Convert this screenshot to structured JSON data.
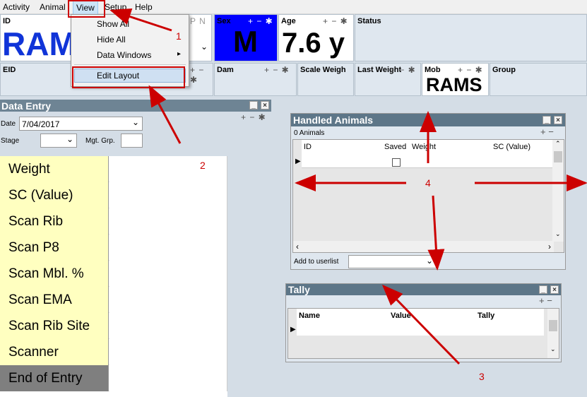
{
  "menubar": {
    "items": [
      "Activity",
      "Animal",
      "View",
      "Setup",
      "Help"
    ]
  },
  "view_menu": {
    "items": [
      "Show All",
      "Hide All",
      "Data Windows",
      "Edit Layout"
    ],
    "submenu_arrow": "▸"
  },
  "top_panels": {
    "id": {
      "label": "ID",
      "value": "RAM"
    },
    "pn": "P N",
    "sex": {
      "label": "Sex",
      "value": "M",
      "color": "#0000ff"
    },
    "age": {
      "label": "Age",
      "value": "7.6 y"
    },
    "status": {
      "label": "Status"
    },
    "eid": {
      "label": "EID"
    },
    "dam": {
      "label": "Dam"
    },
    "scale_weight": {
      "label": "Scale Weigh"
    },
    "last_weight": {
      "label": "Last Weight"
    },
    "mob": {
      "label": "Mob",
      "value": "RAMS"
    },
    "group": {
      "label": "Group"
    }
  },
  "panel_controls": "+ − ✱",
  "data_entry": {
    "title": "Data Entry",
    "date_label": "Date",
    "date_value": "7/04/2017",
    "stage_label": "Stage",
    "mgt_label": "Mgt. Grp.",
    "fields": [
      "Weight",
      "SC (Value)",
      "Scan Rib",
      "Scan P8",
      "Scan Mbl. %",
      "Scan EMA",
      "Scan Rib Site",
      "Scanner",
      "End of Entry"
    ]
  },
  "handled_animals": {
    "title": "Handled Animals",
    "count": "0 Animals",
    "columns": [
      "ID",
      "Saved",
      "Weight",
      "SC (Value)"
    ],
    "add_to_userlist": "Add to userlist"
  },
  "tally": {
    "title": "Tally",
    "columns": [
      "Name",
      "Value",
      "Tally"
    ]
  },
  "annotations": [
    "1",
    "2",
    "3",
    "4"
  ],
  "colors": {
    "accent": "#cc0000",
    "titlebar": "#5d7688",
    "field_bg": "#ffffc0",
    "end_entry_bg": "#7f7f7f"
  }
}
